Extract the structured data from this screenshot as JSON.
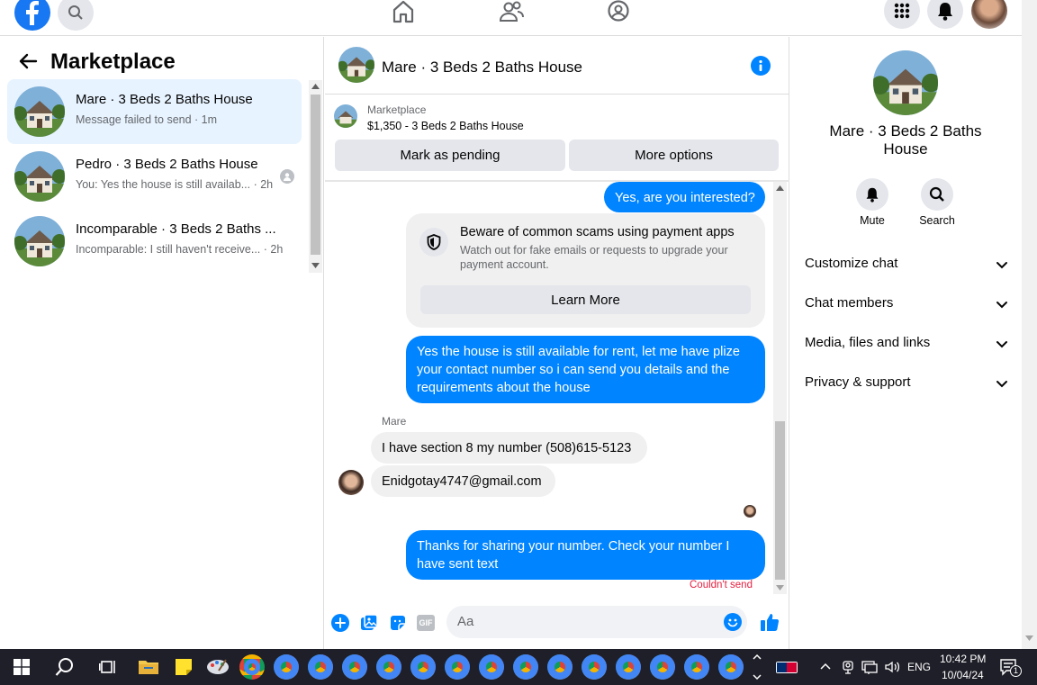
{
  "left": {
    "title": "Marketplace",
    "conversations": [
      {
        "name": "Mare · 3 Beds 2 Baths House",
        "preview": "Message failed to send · 1m"
      },
      {
        "name": "Pedro · 3 Beds 2 Baths House",
        "preview": "You: Yes the house is still availab...  · 2h"
      },
      {
        "name": "Incomparable · 3 Beds 2 Baths ...",
        "preview": "Incomparable: I still haven't receive... · 2h"
      }
    ]
  },
  "chat": {
    "header_title": "Mare · 3 Beds 2 Baths House",
    "listing_label": "Marketplace",
    "listing_detail": "$1,350 - 3 Beds 2 Baths House",
    "mark_pending": "Mark as pending",
    "more_options": "More options",
    "messages": {
      "m1": "Yes, are you interested?",
      "scam_title": "Beware of common scams using payment apps",
      "scam_body": "Watch out for fake emails or requests to upgrade your payment account.",
      "learn_more": "Learn More",
      "m2": "Yes the house is still available  for rent, let me have plize your contact number so i can send you details and the requirements about the house",
      "sender": "Mare",
      "m3": "I have section 8 my number (508)615-5123",
      "m4": "Enidgotay4747@gmail.com",
      "m5": "Thanks for sharing your number.  Check your number I have sent text",
      "failed": "Couldn't send"
    },
    "composer_placeholder": "Aa",
    "gif_label": "GIF"
  },
  "info": {
    "title": "Mare · 3 Beds 2 Baths House",
    "mute": "Mute",
    "search": "Search",
    "sections": [
      "Customize chat",
      "Chat members",
      "Media, files and links",
      "Privacy & support"
    ]
  },
  "taskbar": {
    "lang": "ENG",
    "time": "10:42 PM",
    "date": "10/04/24",
    "notif_count": "1"
  },
  "colors": {
    "accent": "#0084ff",
    "fb_blue": "#1877f2",
    "failed": "#e41e3f"
  }
}
